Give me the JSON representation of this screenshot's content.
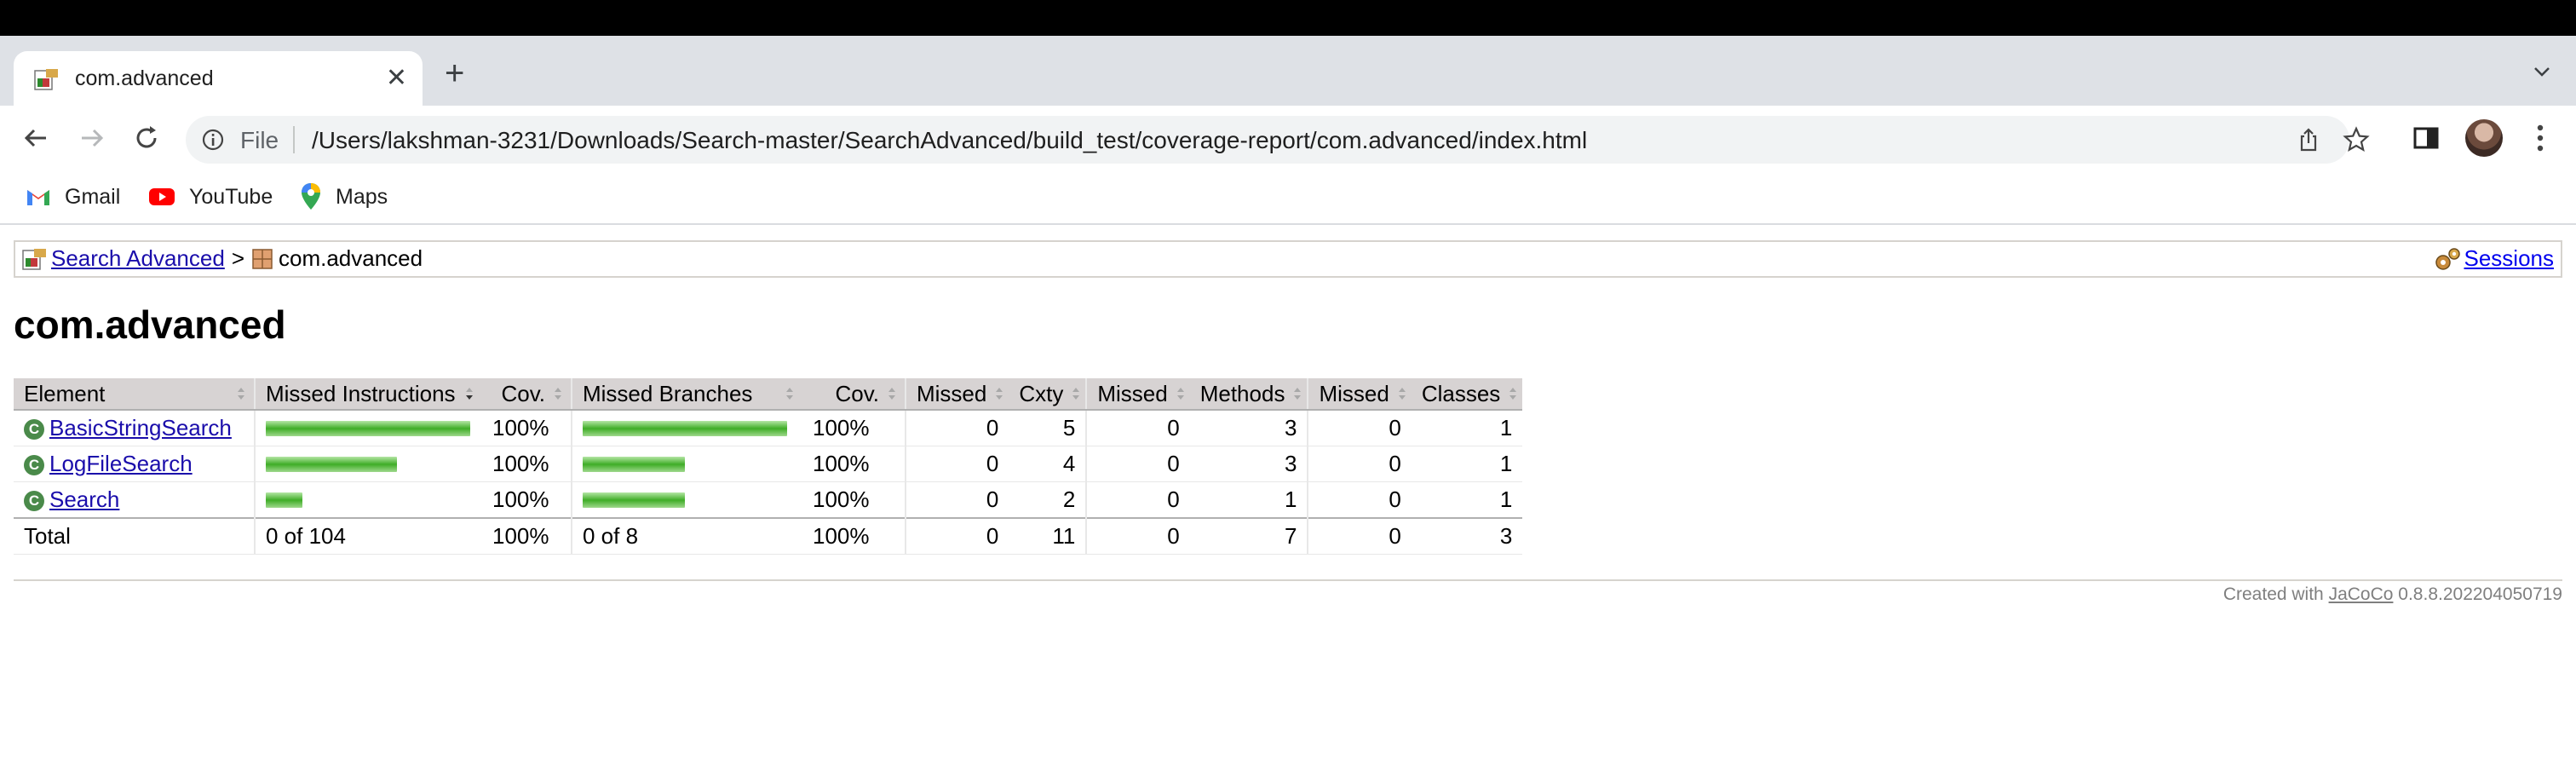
{
  "browser": {
    "tab_title": "com.advanced",
    "address_scheme": "File",
    "url": "/Users/lakshman-3231/Downloads/Search-master/SearchAdvanced/build_test/coverage-report/com.advanced/index.html",
    "bookmarks": [
      "Gmail",
      "YouTube",
      "Maps"
    ]
  },
  "breadcrumb": {
    "root_label": "Search Advanced",
    "separator": ">",
    "current": "com.advanced",
    "sessions_label": "Sessions"
  },
  "page_title": "com.advanced",
  "table": {
    "headers": [
      "Element",
      "Missed Instructions",
      "Cov.",
      "Missed Branches",
      "Cov.",
      "Missed",
      "Cxty",
      "Missed",
      "Methods",
      "Missed",
      "Classes"
    ],
    "rows": [
      {
        "name": "BasicStringSearch",
        "instr_fraction": 1.0,
        "instr_cov": "100%",
        "branch_fraction": 1.0,
        "branch_cov": "100%",
        "missed_cxty": "0",
        "cxty": "5",
        "missed_methods": "0",
        "methods": "3",
        "missed_classes": "0",
        "classes": "1"
      },
      {
        "name": "LogFileSearch",
        "instr_fraction": 0.64,
        "instr_cov": "100%",
        "branch_fraction": 0.5,
        "branch_cov": "100%",
        "missed_cxty": "0",
        "cxty": "4",
        "missed_methods": "0",
        "methods": "3",
        "missed_classes": "0",
        "classes": "1"
      },
      {
        "name": "Search",
        "instr_fraction": 0.18,
        "instr_cov": "100%",
        "branch_fraction": 0.5,
        "branch_cov": "100%",
        "missed_cxty": "0",
        "cxty": "2",
        "missed_methods": "0",
        "methods": "1",
        "missed_classes": "0",
        "classes": "1"
      }
    ],
    "total": {
      "label": "Total",
      "instr": "0 of 104",
      "instr_cov": "100%",
      "branch": "0 of 8",
      "branch_cov": "100%",
      "missed_cxty": "0",
      "cxty": "11",
      "missed_methods": "0",
      "methods": "7",
      "missed_classes": "0",
      "classes": "3"
    }
  },
  "footer": {
    "prefix": "Created with",
    "link": "JaCoCo",
    "version": "0.8.8.202204050719"
  },
  "colors": {
    "bar_green": "#3fad27",
    "header_bg": "#d7d3d3",
    "link": "#1a0dab"
  }
}
